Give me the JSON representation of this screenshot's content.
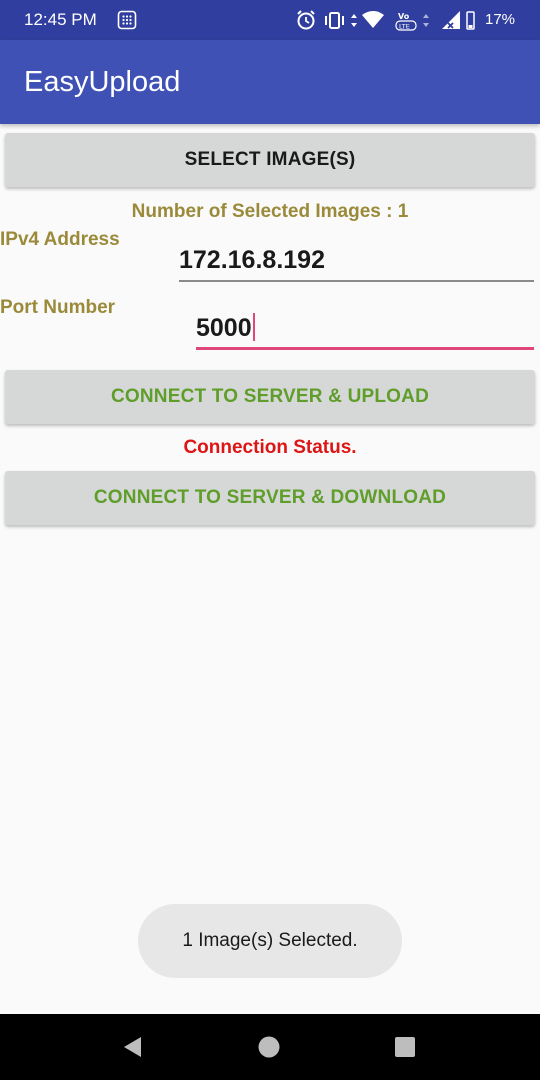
{
  "status_bar": {
    "time": "12:45 PM",
    "battery": "17%",
    "icons": [
      "grid-icon",
      "alarm-icon",
      "vibrate-icon",
      "data-arrows-icon",
      "wifi-icon",
      "volte-icon",
      "signal-icon",
      "battery-icon"
    ]
  },
  "app_bar": {
    "title": "EasyUpload"
  },
  "main": {
    "select_button": "SELECT IMAGE(S)",
    "selected_count": "Number of Selected Images : 1",
    "ip_label": "IPv4 Address",
    "ip_value": "172.16.8.192",
    "port_label": "Port Number",
    "port_value": "5000",
    "upload_button": "CONNECT TO SERVER & UPLOAD",
    "connection_status": "Connection Status.",
    "download_button": "CONNECT TO SERVER & DOWNLOAD"
  },
  "toast": {
    "message": "1 Image(s) Selected."
  },
  "nav_bar": {
    "buttons": [
      "back-icon",
      "home-icon",
      "recents-icon"
    ]
  },
  "colors": {
    "app_bar": "#3f51b5",
    "status_bar": "#303f9f",
    "label_olive": "#9a8a3a",
    "button_green": "#5f9e2a",
    "status_red": "#dd1515",
    "accent_pink": "#e0457b"
  }
}
